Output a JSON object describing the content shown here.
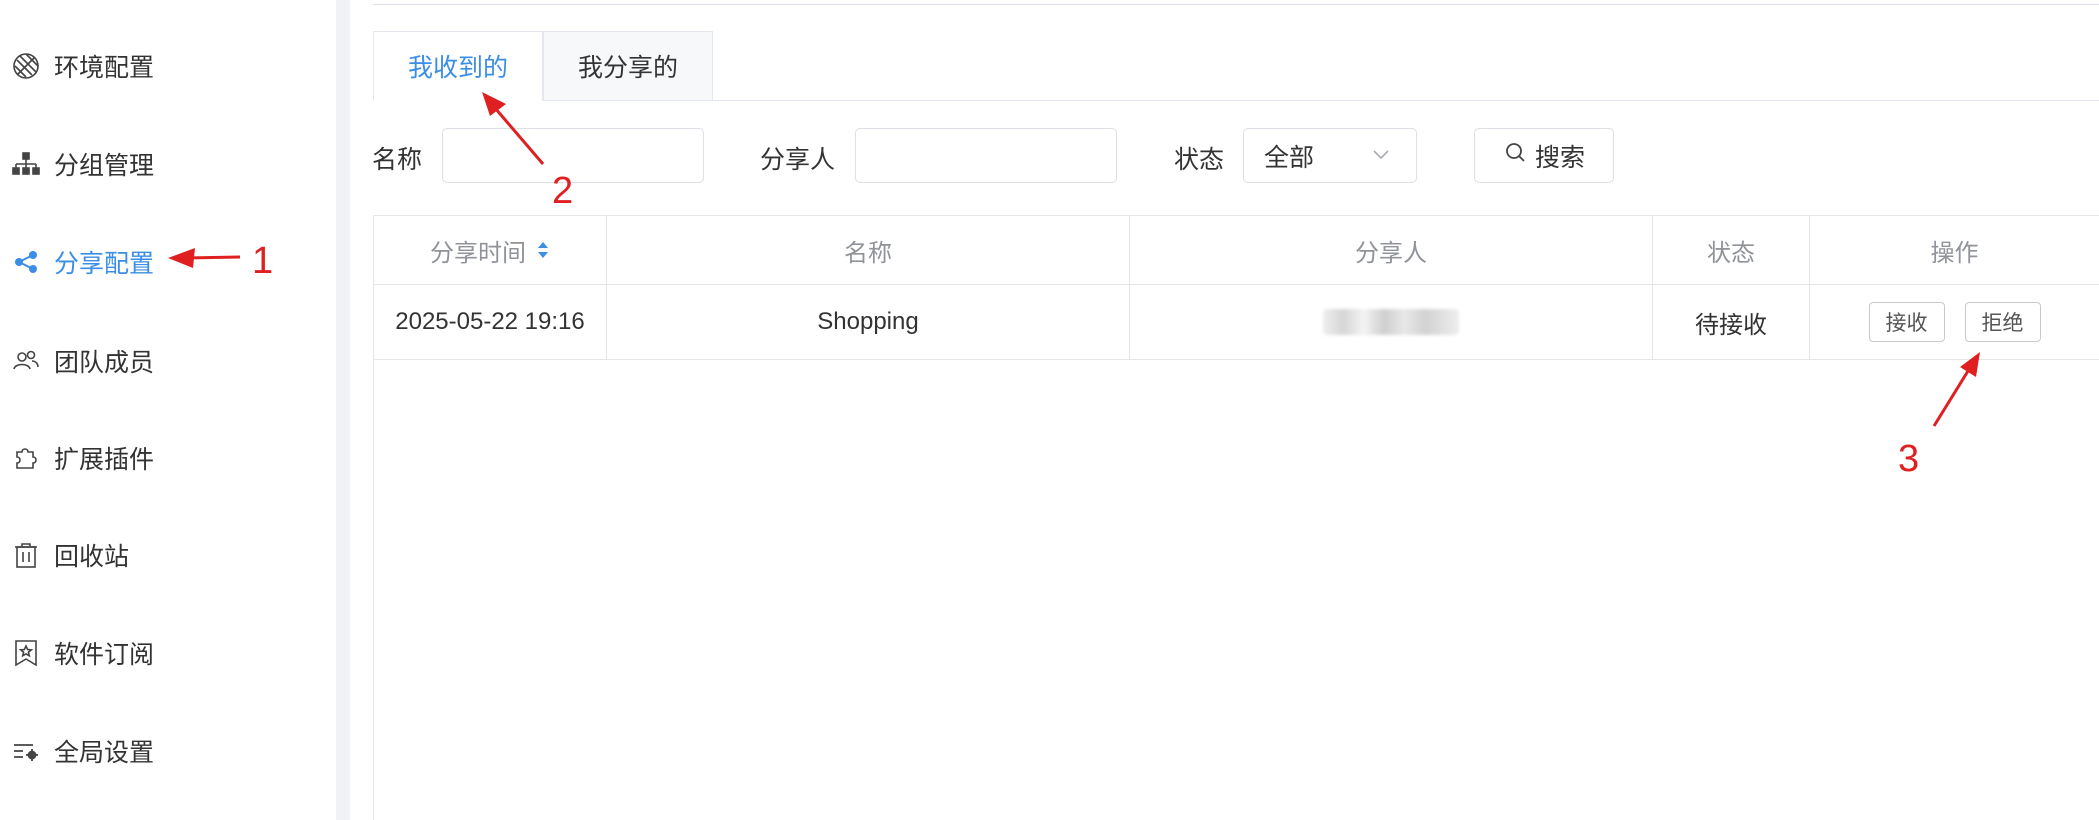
{
  "sidebar": {
    "items": [
      {
        "label": "环境配置",
        "icon": "globe-icon",
        "active": false
      },
      {
        "label": "分组管理",
        "icon": "org-chart-icon",
        "active": false
      },
      {
        "label": "分享配置",
        "icon": "share-icon",
        "active": true
      },
      {
        "label": "团队成员",
        "icon": "team-icon",
        "active": false
      },
      {
        "label": "扩展插件",
        "icon": "puzzle-icon",
        "active": false
      },
      {
        "label": "回收站",
        "icon": "trash-icon",
        "active": false
      },
      {
        "label": "软件订阅",
        "icon": "bookmark-star-icon",
        "active": false
      },
      {
        "label": "全局设置",
        "icon": "settings-list-icon",
        "active": false
      }
    ]
  },
  "tabs": [
    {
      "label": "我收到的",
      "active": true
    },
    {
      "label": "我分享的",
      "active": false
    }
  ],
  "filters": {
    "name_label": "名称",
    "name_value": "",
    "sharer_label": "分享人",
    "sharer_value": "",
    "status_label": "状态",
    "status_value": "全部",
    "search_label": "搜索"
  },
  "table": {
    "columns": [
      "分享时间",
      "名称",
      "分享人",
      "状态",
      "操作"
    ],
    "rows": [
      {
        "time": "2025-05-22 19:16",
        "name": "Shopping",
        "sharer": "",
        "status": "待接收",
        "actions": [
          "接收",
          "拒绝"
        ]
      }
    ]
  },
  "annotations": {
    "labels": [
      "1",
      "2",
      "3"
    ],
    "color": "#e02020"
  },
  "colors": {
    "accent": "#3a8ee6",
    "divider": "#f0f2f5"
  }
}
